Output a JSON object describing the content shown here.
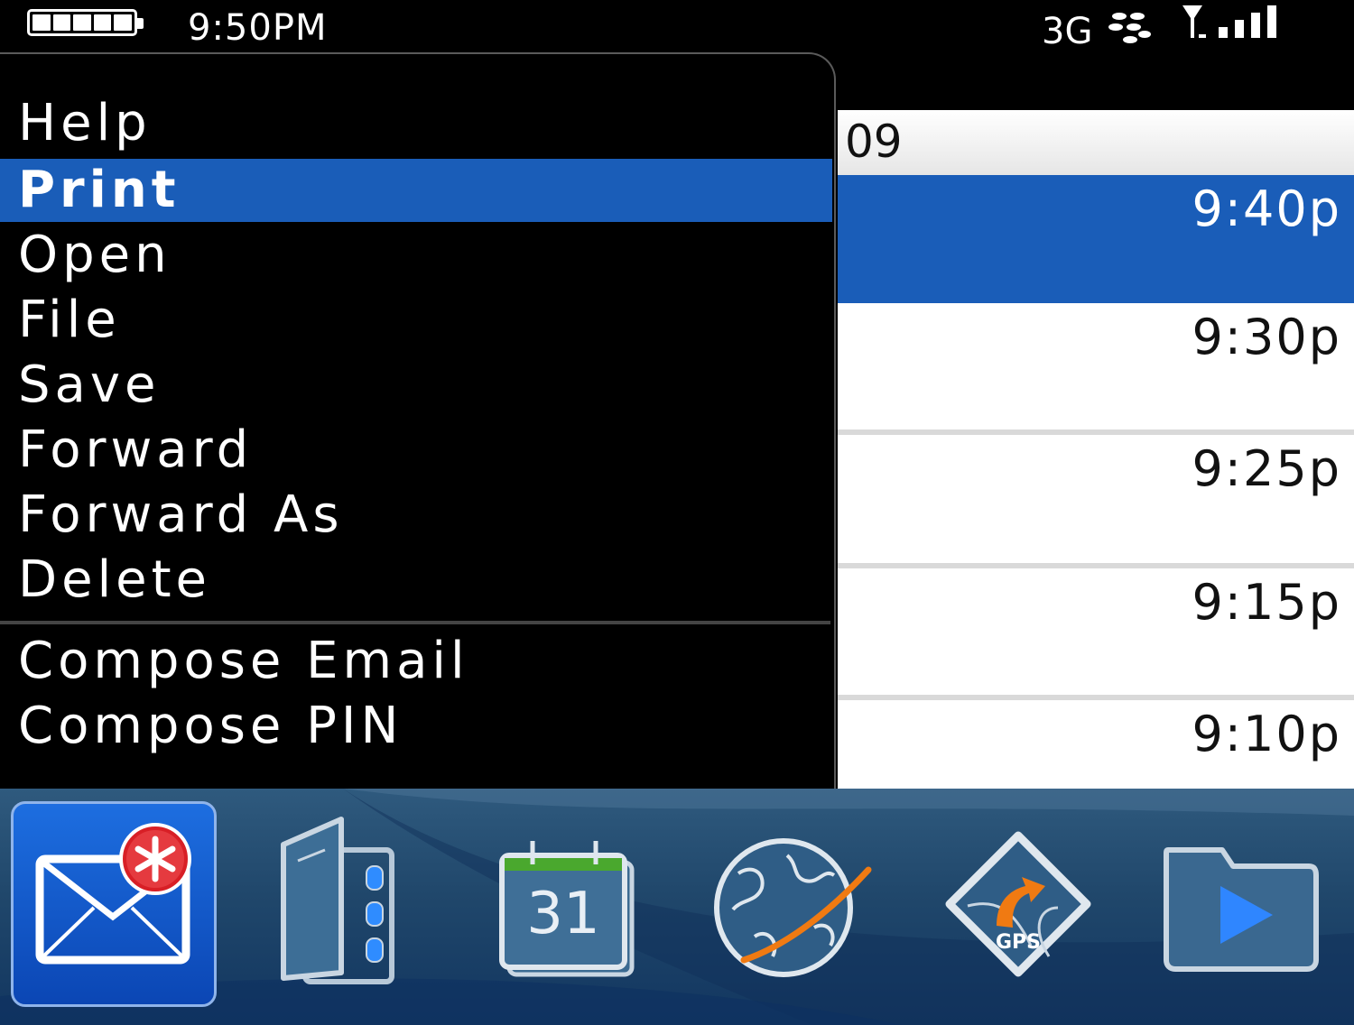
{
  "status_bar": {
    "time": "9:50PM",
    "network": "3G",
    "battery_level": 1.0,
    "signal_bars": 4
  },
  "menu": {
    "items": [
      {
        "label": "Help",
        "selected": false
      },
      {
        "label": "Print",
        "selected": true
      },
      {
        "label": "Open",
        "selected": false
      },
      {
        "label": "File",
        "selected": false
      },
      {
        "label": "Save",
        "selected": false
      },
      {
        "label": "Forward",
        "selected": false
      },
      {
        "label": "Forward As",
        "selected": false
      },
      {
        "label": "Delete",
        "selected": false
      },
      {
        "label": "Compose Email",
        "selected": false
      },
      {
        "label": "Compose PIN",
        "selected": false
      }
    ]
  },
  "message_list": {
    "date_header": "09",
    "times": [
      "9:40p",
      "9:30p",
      "9:25p",
      "9:15p",
      "9:10p"
    ],
    "selected_index": 0
  },
  "dock": {
    "calendar_day": "31",
    "gps_label": "GPS"
  },
  "colors": {
    "selection": "#1a5db8",
    "menu_background": "#000000",
    "dock_background": "#20476b",
    "calendar_green": "#4aa82e",
    "accent_orange": "#f07a12",
    "notification_red": "#d81f26"
  }
}
